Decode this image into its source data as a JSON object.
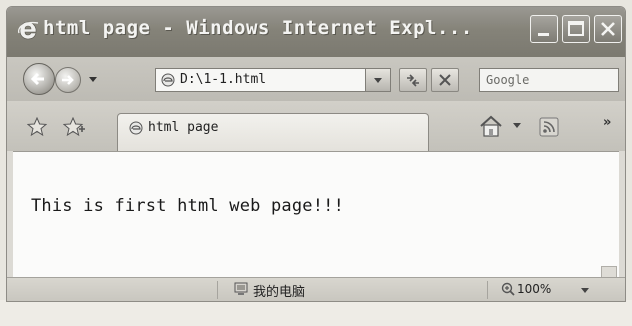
{
  "window": {
    "title": "html page - Windows Internet Expl..."
  },
  "navigation": {
    "address": "D:\\1-1.html",
    "search_placeholder": "Google"
  },
  "tabs": [
    {
      "label": "html page"
    }
  ],
  "content": {
    "text": "This is first html web page!!!"
  },
  "statusbar": {
    "zone_label": "我的电脑",
    "zoom": "100%"
  },
  "colors": {
    "titlebar": "#858379",
    "content_bg": "#fbfbfa"
  },
  "icons": [
    "ie-logo-icon",
    "back-arrow-icon",
    "forward-arrow-icon",
    "page-icon",
    "refresh-icon",
    "stop-icon",
    "favorites-star-icon",
    "add-favorites-icon",
    "home-icon",
    "feeds-icon",
    "computer-icon",
    "zoom-icon",
    "minimize-icon",
    "maximize-icon",
    "close-icon"
  ]
}
